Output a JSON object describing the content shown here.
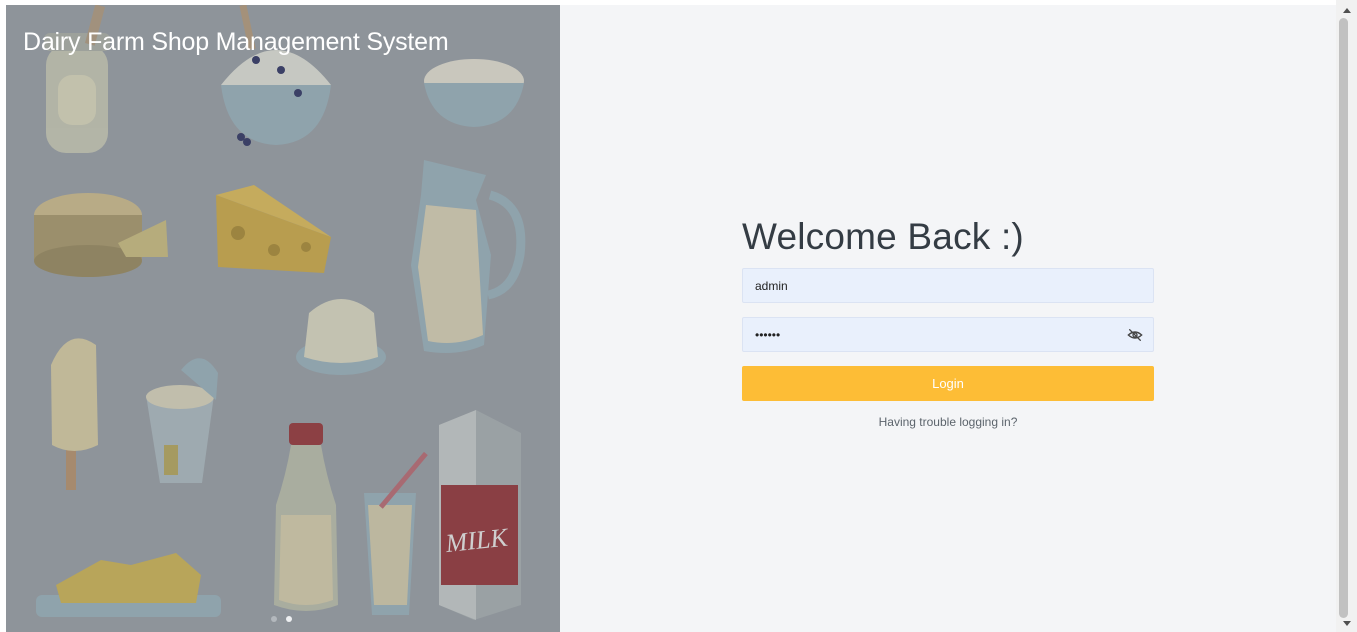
{
  "hero": {
    "title": "Dairy Farm Shop Management System",
    "carousel_dot_count": 2,
    "active_dot": 2,
    "carton_label": "MILK"
  },
  "form": {
    "heading": "Welcome Back :)",
    "username_value": "admin",
    "password_value": "••••••",
    "login_label": "Login",
    "trouble_link": "Having trouble logging in?"
  },
  "colors": {
    "hero_overlay": "#8e949a",
    "panel_bg": "#f4f5f7",
    "input_bg": "#e9f0fc",
    "login_button": "#fdbd36",
    "heading_text": "#343c44"
  },
  "icons": {
    "password_toggle": "eye-off-icon"
  }
}
